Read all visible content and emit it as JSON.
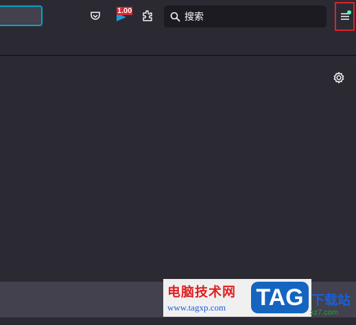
{
  "toolbar": {
    "extension_badge": "1.00",
    "search": {
      "placeholder": "搜索"
    }
  },
  "colors": {
    "toolbar_bg": "#2b2a33",
    "search_bg": "#1c1b22",
    "focus_ring": "#00a7c7",
    "highlight_box": "#e0232b",
    "notification_dot": "#54ffbd"
  },
  "icons": [
    "pocket-icon",
    "extension-badge-icon",
    "extensions-puzzle-icon",
    "search-icon",
    "hamburger-menu-icon",
    "gear-icon"
  ],
  "watermark": {
    "title": "电脑技术网",
    "url": "www.tagxp.com",
    "logo_text": "TAG",
    "side_text": "下载站",
    "side_url": "xz7.com"
  }
}
